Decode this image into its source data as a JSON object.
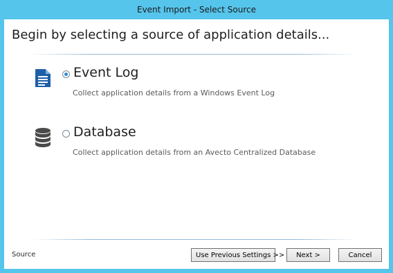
{
  "window": {
    "title": "Event Import - Select Source"
  },
  "page": {
    "heading": "Begin by selecting a source of application details..."
  },
  "options": [
    {
      "label": "Event Log",
      "description": "Collect application details from a Windows Event Log",
      "selected": true,
      "icon": "document-icon"
    },
    {
      "label": "Database",
      "description": "Collect application details from an Avecto Centralized Database",
      "selected": false,
      "icon": "database-icon"
    }
  ],
  "footer": {
    "step_label": "Source",
    "use_previous_label": "Use Previous Settings >>",
    "next_label": "Next >",
    "cancel_label": "Cancel"
  },
  "colors": {
    "titlebar": "#56c5ec",
    "document_icon": "#1e5fa8",
    "database_icon": "#4a4a4a",
    "radio_selected": "#2a8ad4"
  }
}
